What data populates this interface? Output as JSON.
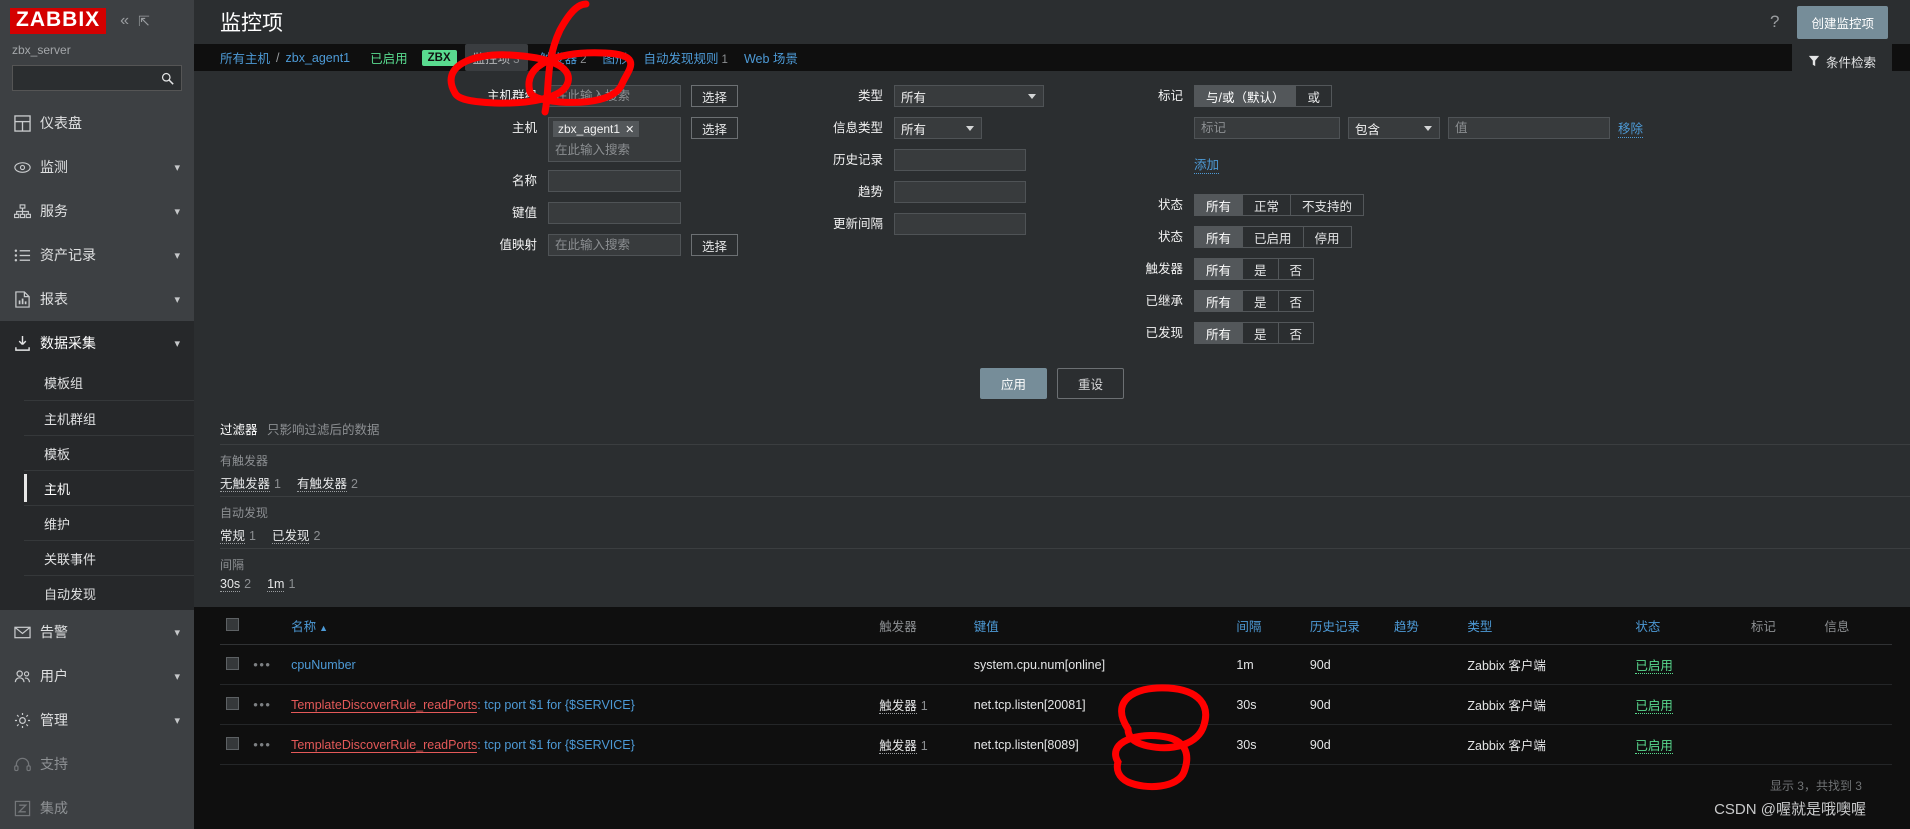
{
  "brand": {
    "logo": "ZABBIX",
    "server": "zbx_server"
  },
  "sidebar": {
    "search_placeholder": "",
    "items": [
      {
        "label": "仪表盘",
        "icon": "dashboard-icon",
        "chevron": false
      },
      {
        "label": "监测",
        "icon": "eye-icon",
        "chevron": true
      },
      {
        "label": "服务",
        "icon": "sitemap-icon",
        "chevron": true
      },
      {
        "label": "资产记录",
        "icon": "list-icon",
        "chevron": true
      },
      {
        "label": "报表",
        "icon": "report-icon",
        "chevron": true
      },
      {
        "label": "数据采集",
        "icon": "download-icon",
        "chevron": true
      }
    ],
    "sub_items": [
      {
        "label": "模板组"
      },
      {
        "label": "主机群组"
      },
      {
        "label": "模板"
      },
      {
        "label": "主机"
      },
      {
        "label": "维护"
      },
      {
        "label": "关联事件"
      },
      {
        "label": "自动发现"
      }
    ],
    "active_sub": "主机",
    "items_lower": [
      {
        "label": "告警",
        "icon": "envelope-icon",
        "chevron": true
      },
      {
        "label": "用户",
        "icon": "users-icon",
        "chevron": true
      },
      {
        "label": "管理",
        "icon": "gear-icon",
        "chevron": true
      }
    ],
    "items_bottom": [
      {
        "label": "支持",
        "icon": "headset-icon"
      },
      {
        "label": "集成",
        "icon": "zbx-square-icon"
      }
    ]
  },
  "header": {
    "title": "监控项",
    "help": "?",
    "create_button": "创建监控项"
  },
  "breadcrumb": {
    "all_hosts": "所有主机",
    "separator": "/",
    "host": "zbx_agent1",
    "enabled": "已启用",
    "agent_badge": "ZBX",
    "tabs": [
      {
        "label": "监控项",
        "count": "3",
        "selected": true
      },
      {
        "label": "触发器",
        "count": "2",
        "selected": false
      },
      {
        "label": "图形",
        "count": "",
        "selected": false
      },
      {
        "label": "自动发现规则",
        "count": "1",
        "selected": false
      },
      {
        "label": "Web 场景",
        "count": "",
        "selected": false
      }
    ],
    "filter_button": "条件检索"
  },
  "filter": {
    "col1": [
      {
        "label": "主机群组",
        "type": "search",
        "value": "",
        "placeholder": "在此输入搜索",
        "button": "选择"
      },
      {
        "label": "主机",
        "type": "multiselect",
        "chips": [
          "zbx_agent1"
        ],
        "placeholder": "在此输入搜索",
        "button": "选择"
      },
      {
        "label": "名称",
        "type": "text",
        "value": "",
        "placeholder": ""
      },
      {
        "label": "键值",
        "type": "text",
        "value": "",
        "placeholder": ""
      },
      {
        "label": "值映射",
        "type": "search",
        "value": "",
        "placeholder": "在此输入搜索",
        "button": "选择"
      }
    ],
    "col2": [
      {
        "label": "类型",
        "type": "select",
        "value": "所有"
      },
      {
        "label": "信息类型",
        "type": "select",
        "value": "所有"
      },
      {
        "label": "历史记录",
        "type": "text",
        "value": ""
      },
      {
        "label": "趋势",
        "type": "text",
        "value": ""
      },
      {
        "label": "更新间隔",
        "type": "text",
        "value": ""
      }
    ],
    "tags": {
      "label": "标记",
      "operator_options": [
        "与/或（默认）",
        "或"
      ],
      "operator_selected": "与/或（默认）",
      "tag_placeholder": "标记",
      "condition_value": "包含",
      "value_placeholder": "值",
      "remove_link": "移除",
      "add_link": "添加"
    },
    "state_rows": [
      {
        "label": "状态",
        "options": [
          "所有",
          "正常",
          "不支持的"
        ],
        "selected": "所有"
      },
      {
        "label": "状态",
        "options": [
          "所有",
          "已启用",
          "停用"
        ],
        "selected": "所有"
      },
      {
        "label": "触发器",
        "options": [
          "所有",
          "是",
          "否"
        ],
        "selected": "所有"
      },
      {
        "label": "已继承",
        "options": [
          "所有",
          "是",
          "否"
        ],
        "selected": "所有"
      },
      {
        "label": "已发现",
        "options": [
          "所有",
          "是",
          "否"
        ],
        "selected": "所有"
      }
    ],
    "apply": "应用",
    "reset": "重设"
  },
  "subfilter": {
    "title": "过滤器",
    "note": "只影响过滤后的数据",
    "blocks": [
      {
        "caption": "有触发器",
        "options": [
          {
            "name": "无触发器",
            "count": "1"
          },
          {
            "name": "有触发器",
            "count": "2"
          }
        ]
      },
      {
        "caption": "自动发现",
        "options": [
          {
            "name": "常规",
            "count": "1"
          },
          {
            "name": "已发现",
            "count": "2"
          }
        ]
      },
      {
        "caption": "间隔",
        "options": [
          {
            "name": "30s",
            "count": "2"
          },
          {
            "name": "1m",
            "count": "1"
          }
        ]
      }
    ]
  },
  "table": {
    "headers": {
      "name": "名称",
      "sort_arrow": "▲",
      "triggers": "触发器",
      "key": "键值",
      "interval": "间隔",
      "history": "历史记录",
      "trends": "趋势",
      "type": "类型",
      "state": "状态",
      "tags": "标记",
      "info": "信息"
    },
    "rows": [
      {
        "dots": "•••",
        "name_prefix": "",
        "name": "cpuNumber",
        "name_style": "blue",
        "triggers": "",
        "triggers_count": "",
        "key": "system.cpu.num[online]",
        "interval": "1m",
        "history": "90d",
        "trends": "",
        "type": "Zabbix 客户端",
        "state": "已启用",
        "tags": "",
        "info": ""
      },
      {
        "dots": "•••",
        "name_prefix": "TemplateDiscoverRule_readPorts",
        "name": ": tcp port $1 for {$SERVICE}",
        "name_style": "red-blue",
        "triggers": "触发器",
        "triggers_count": "1",
        "key": "net.tcp.listen[20081]",
        "interval": "30s",
        "history": "90d",
        "trends": "",
        "type": "Zabbix 客户端",
        "state": "已启用",
        "tags": "",
        "info": ""
      },
      {
        "dots": "•••",
        "name_prefix": "TemplateDiscoverRule_readPorts",
        "name": ": tcp port $1 for {$SERVICE}",
        "name_style": "red-blue",
        "triggers": "触发器",
        "triggers_count": "1",
        "key": "net.tcp.listen[8089]",
        "interval": "30s",
        "history": "90d",
        "trends": "",
        "type": "Zabbix 客户端",
        "state": "已启用",
        "tags": "",
        "info": ""
      }
    ],
    "footer": "显示 3，共找到 3"
  },
  "watermark": "CSDN @喔就是哦噢喔",
  "colors": {
    "brand_red": "#d40000",
    "link_blue": "#4d9ad6",
    "green": "#59db8f",
    "red_text": "#e45959",
    "annotation_red": "#ff0000"
  }
}
